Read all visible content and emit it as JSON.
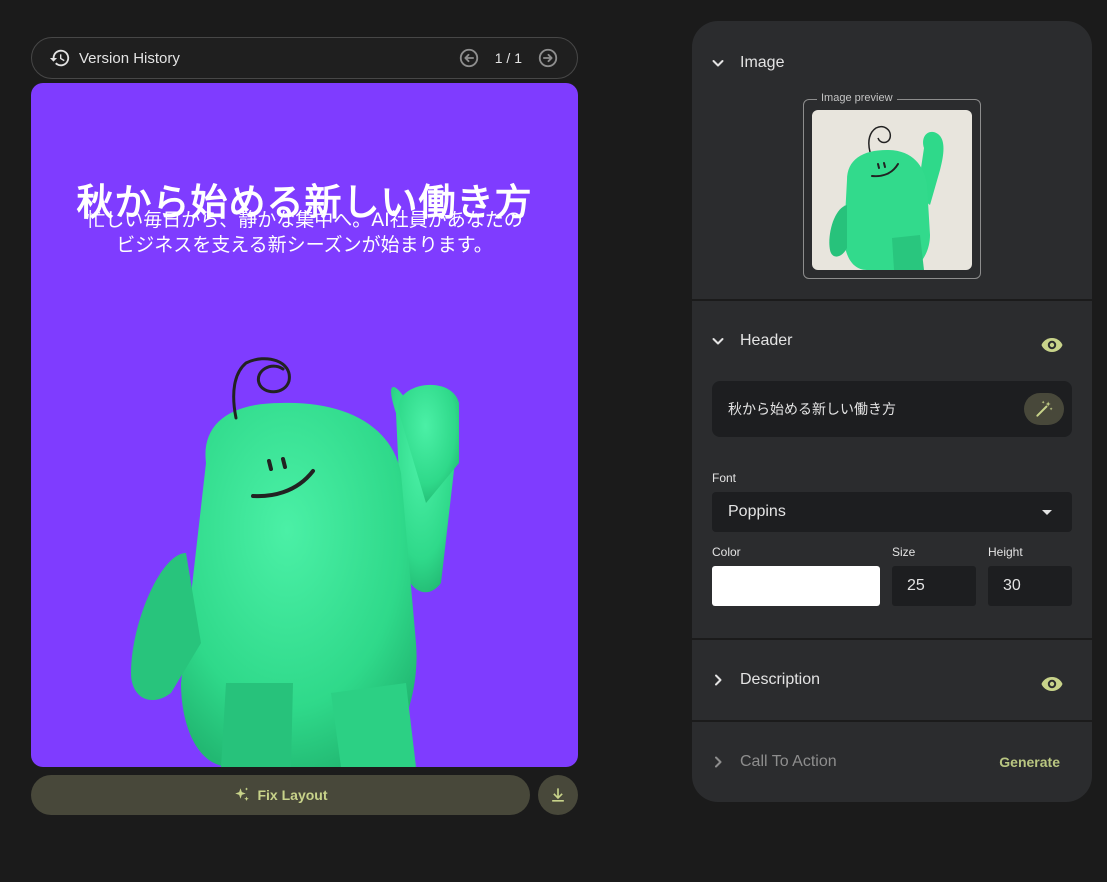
{
  "version_history": {
    "label": "Version History",
    "page_indicator": "1 / 1",
    "icons": {
      "history": "history-icon",
      "prev": "arrow-left-circle-icon",
      "next": "arrow-right-circle-icon"
    }
  },
  "canvas": {
    "headline": "秋から始める新しい働き方",
    "description": "忙しい毎日から、静かな集中へ。AI社員があなたのビジネスを支える新シーズンが始まります。",
    "background_color": "#7f3cff",
    "image": "green-fuzzy-mascot-waving"
  },
  "actions": {
    "fix_layout_label": "Fix Layout",
    "icons": {
      "fix_layout": "sparkle-icon",
      "download": "download-icon"
    }
  },
  "panel": {
    "image_section": {
      "title": "Image",
      "preview_legend": "Image preview"
    },
    "header_section": {
      "title": "Header",
      "text_value": "秋から始める新しい働き方",
      "font_label": "Font",
      "font_value": "Poppins",
      "color_label": "Color",
      "color_value": "#ffffff",
      "size_label": "Size",
      "size_value": "25",
      "height_label": "Height",
      "height_value": "30"
    },
    "description_section": {
      "title": "Description"
    },
    "cta_section": {
      "title": "Call To Action",
      "generate_label": "Generate"
    },
    "accent_color": "#c8d38a"
  }
}
